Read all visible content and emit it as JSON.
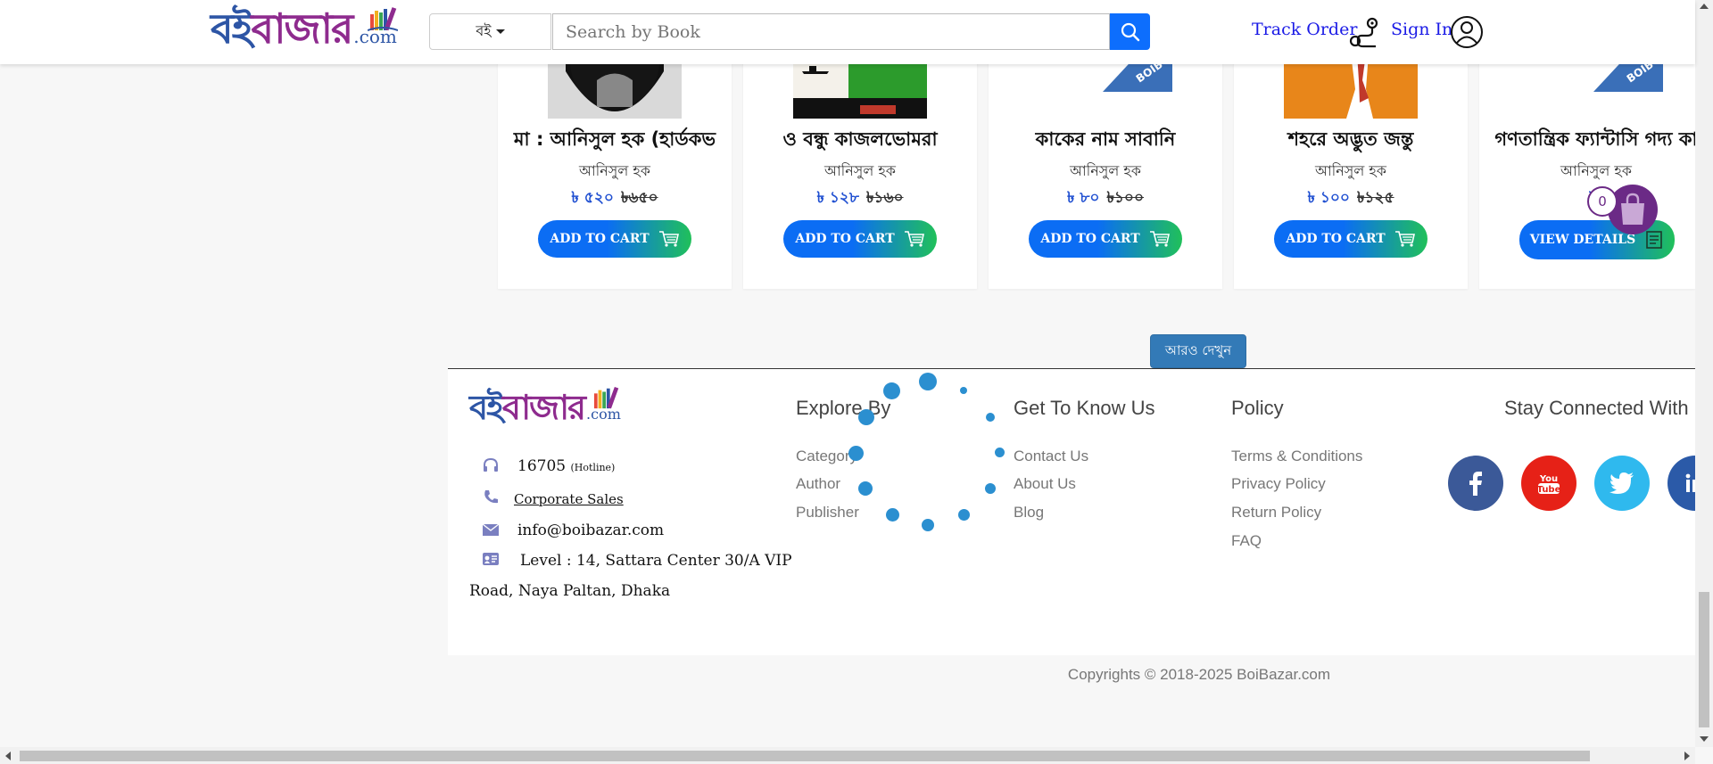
{
  "header": {
    "logo_text_a": "বই",
    "logo_text_b": "বাজার",
    "logo_com": ".com",
    "category_select": "বই",
    "search_placeholder": "Search by Book",
    "track_order": "Track Order",
    "sign_in": "Sign In"
  },
  "products": [
    {
      "title": "মা : আনিসুল হক (হার্ডকভ",
      "author": "আনিসুল হক",
      "price": "৳ ৫২০",
      "old_price": "৳৬৫০",
      "button": "ADD TO CART"
    },
    {
      "title": "ও বন্ধু কাজলভোমরা",
      "author": "আনিসুল হক",
      "price": "৳ ১২৮",
      "old_price": "৳১৬০",
      "button": "ADD TO CART"
    },
    {
      "title": "কাকের নাম সাবানি",
      "author": "আনিসুল হক",
      "price": "৳ ৮০",
      "old_price": "৳১০০",
      "button": "ADD TO CART"
    },
    {
      "title": "শহরে অদ্ভুত জন্তু",
      "author": "আনিসুল হক",
      "price": "৳ ১০০",
      "old_price": "৳১২৫",
      "button": "ADD TO CART"
    },
    {
      "title": "গণতান্ত্রিক ফ্যান্টাসি গদ্য কা",
      "author": "আনিসুল হক",
      "price": "৳",
      "old_price": "",
      "button": "VIEW DETAILS"
    }
  ],
  "cover_badge": "BOIB",
  "cart": {
    "count": "0"
  },
  "see_more": "আরও দেখুন",
  "footer": {
    "logo_text_a": "বই",
    "logo_text_b": "বাজার",
    "logo_com": ".com",
    "hotline_number": "16705",
    "hotline_label": "(Hotline)",
    "corporate_sales": "Corporate Sales",
    "email": "info@boibazar.com",
    "address_line1": "Level : 14, Sattara Center 30/A VIP",
    "address_line2": "Road, Naya Paltan, Dhaka",
    "explore_heading": "Explore By",
    "explore_links": [
      "Category",
      "Author",
      "Publisher"
    ],
    "know_heading": "Get To Know Us",
    "know_links": [
      "Contact Us",
      "About Us",
      "Blog"
    ],
    "policy_heading": "Policy",
    "policy_links": [
      "Terms & Conditions",
      "Privacy Policy",
      "Return Policy",
      "FAQ"
    ],
    "connect_heading": "Stay Connected With Us",
    "social_youtube_label": "You\nTube",
    "copyright": "Copyrights © 2018-2025 BoiBazar.com"
  },
  "colors": {
    "primary_blue": "#0b6df4",
    "cart_green": "#20c05a",
    "brand_purple": "#6b2a86",
    "facebook": "#3b5998",
    "youtube": "#e62117",
    "twitter": "#2fb9ee",
    "linkedin": "#2b5aa8",
    "loader": "#2b8fd0"
  }
}
